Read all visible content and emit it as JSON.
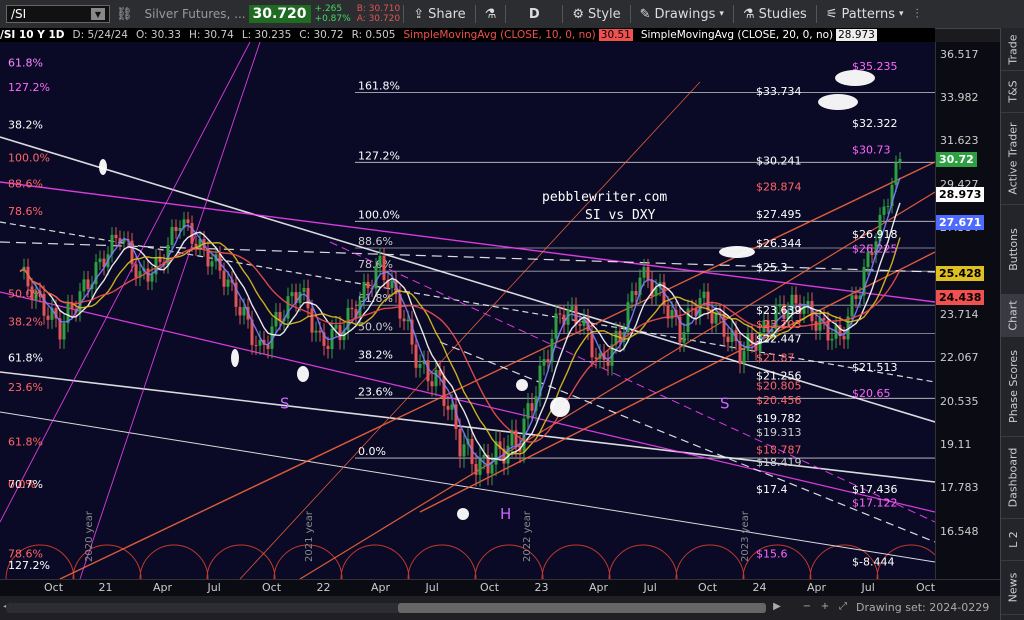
{
  "toolbar": {
    "symbol": "/SI",
    "description": "Silver Futures, ...",
    "last": "30.720",
    "net_change": "+.265",
    "pct_change": "+0.87%",
    "bid": "B: 30.710",
    "ask": "A: 30.720",
    "share_label": "Share",
    "period_label": "D",
    "style_label": "Style",
    "drawings_label": "Drawings",
    "studies_label": "Studies",
    "patterns_label": "Patterns"
  },
  "study_bar": {
    "symbol_period": "/SI 10 Y 1D",
    "date": "D: 5/24/24",
    "open": "O: 30.33",
    "high": "H: 30.74",
    "low": "L: 30.235",
    "close": "C: 30.72",
    "range": "R: 0.505",
    "sma10_label": "SimpleMovingAvg (CLOSE, 10, 0, no)",
    "sma10_value": "30.51",
    "sma20_label": "SimpleMovingAvg (CLOSE, 20, 0, no)",
    "sma20_value": "28.973"
  },
  "chart_data": {
    "type": "line",
    "title": "",
    "watermark": [
      "pebblewriter.com",
      "SI vs DXY"
    ],
    "x_ticks": [
      "Oct",
      "21",
      "Apr",
      "Jul",
      "Oct",
      "22",
      "Apr",
      "Jul",
      "Oct",
      "23",
      "Apr",
      "Jul",
      "Oct",
      "24",
      "Apr",
      "Jul",
      "Oct"
    ],
    "year_labels": [
      "2020 year",
      "2021 year",
      "2022 year",
      "2023 year"
    ],
    "y_ticks": [
      36.517,
      33.982,
      31.623,
      29.427,
      27.384,
      25.482,
      23.714,
      22.067,
      20.535,
      19.11,
      17.783,
      16.548
    ],
    "ylim": [
      15.3,
      37.3
    ],
    "log_scale": true,
    "price_labels": [
      {
        "value": 30.72,
        "text": "30.72",
        "color": "#2ea043"
      },
      {
        "value": 28.973,
        "text": "28.973",
        "color": "#ffffff"
      },
      {
        "value": 27.671,
        "text": "27.671",
        "color": "#4f6bff"
      },
      {
        "value": 25.428,
        "text": "25.428",
        "color": "#e0c020"
      },
      {
        "value": 24.438,
        "text": "24.438",
        "color": "#f05050"
      }
    ],
    "series": [
      {
        "name": "SimpleMovingAvg (CLOSE, 10, 0, no)",
        "color": "#8080ff"
      },
      {
        "name": "SimpleMovingAvg (CLOSE, 20, 0, no)",
        "color": "#ffffff"
      }
    ],
    "close_path": [
      [
        "2020-09",
        25.5
      ],
      [
        "2020-10",
        24.2
      ],
      [
        "2020-11",
        23.2
      ],
      [
        "2020-12",
        24.5
      ],
      [
        "2021-01",
        25.8
      ],
      [
        "2021-02",
        27.2
      ],
      [
        "2021-03",
        25.2
      ],
      [
        "2021-04",
        25.8
      ],
      [
        "2021-05",
        27.8
      ],
      [
        "2021-06",
        26.5
      ],
      [
        "2021-07",
        25.6
      ],
      [
        "2021-08",
        24.0
      ],
      [
        "2021-09",
        22.3
      ],
      [
        "2021-10",
        23.7
      ],
      [
        "2021-11",
        24.8
      ],
      [
        "2021-12",
        22.6
      ],
      [
        "2022-01",
        23.1
      ],
      [
        "2022-02",
        24.3
      ],
      [
        "2022-03",
        25.8
      ],
      [
        "2022-04",
        24.0
      ],
      [
        "2022-05",
        21.7
      ],
      [
        "2022-06",
        21.2
      ],
      [
        "2022-07",
        19.2
      ],
      [
        "2022-08",
        18.4
      ],
      [
        "2022-09",
        18.9
      ],
      [
        "2022-10",
        19.3
      ],
      [
        "2022-11",
        21.4
      ],
      [
        "2022-12",
        23.8
      ],
      [
        "2023-01",
        23.6
      ],
      [
        "2023-02",
        21.8
      ],
      [
        "2023-03",
        22.9
      ],
      [
        "2023-04",
        25.4
      ],
      [
        "2023-05",
        24.6
      ],
      [
        "2023-06",
        23.0
      ],
      [
        "2023-07",
        24.4
      ],
      [
        "2023-08",
        23.4
      ],
      [
        "2023-09",
        22.3
      ],
      [
        "2023-10",
        22.9
      ],
      [
        "2023-11",
        23.9
      ],
      [
        "2023-12",
        24.2
      ],
      [
        "2024-01",
        23.3
      ],
      [
        "2024-02",
        22.8
      ],
      [
        "2024-03",
        24.9
      ],
      [
        "2024-04",
        27.6
      ],
      [
        "2024-05",
        30.72
      ]
    ],
    "fib_levels": [
      {
        "text": "161.8%",
        "value": 34.3,
        "color": "#ffffff"
      },
      {
        "text": "127.2%",
        "value": 30.55,
        "color": "#ffffff"
      },
      {
        "text": "100.0%",
        "value": 27.7,
        "color": "#ffffff"
      },
      {
        "text": "88.6%",
        "value": 26.5,
        "color": "#cccccc"
      },
      {
        "text": "78.6%",
        "value": 25.5,
        "color": "#cccccc"
      },
      {
        "text": "61.8%",
        "value": 24.1,
        "color": "#cccccc"
      },
      {
        "text": "50.0%",
        "value": 23.0,
        "color": "#cccccc"
      },
      {
        "text": "38.2%",
        "value": 21.95,
        "color": "#ffffff"
      },
      {
        "text": "23.6%",
        "value": 20.65,
        "color": "#ffffff"
      },
      {
        "text": "0.0%",
        "value": 18.7,
        "color": "#ffffff"
      }
    ],
    "right_price_annotations": [
      {
        "text": "$35.235",
        "value": 35.6,
        "color": "#ff66ff"
      },
      {
        "text": "$33.734",
        "value": 34.15,
        "color": "#ffffff"
      },
      {
        "text": "$32.322",
        "value": 32.4,
        "color": "#ffffff"
      },
      {
        "text": "$30.73",
        "value": 31.0,
        "color": "#ff66ff"
      },
      {
        "text": "$30.241",
        "value": 30.45,
        "color": "#ffffff"
      },
      {
        "text": "$28.874",
        "value": 29.15,
        "color": "#ff6666"
      },
      {
        "text": "$27.495",
        "value": 27.85,
        "color": "#ffffff"
      },
      {
        "text": "$26.918",
        "value": 26.95,
        "color": "#ffffff"
      },
      {
        "text": "$26.344",
        "value": 26.55,
        "color": "#ffffff"
      },
      {
        "text": "$26.225",
        "value": 26.3,
        "color": "#ff66ff"
      },
      {
        "text": "$25.3",
        "value": 25.5,
        "color": "#ffffff"
      },
      {
        "text": "$23.639",
        "value": 23.75,
        "color": "#ffffff"
      },
      {
        "text": "$23.203",
        "value": 23.2,
        "color": "#ff6666"
      },
      {
        "text": "$22.447",
        "value": 22.65,
        "color": "#ffffff"
      },
      {
        "text": "$21.87",
        "value": 21.95,
        "color": "#ff6666"
      },
      {
        "text": "$21.513",
        "value": 21.6,
        "color": "#ffffff"
      },
      {
        "text": "$21.256",
        "value": 21.3,
        "color": "#ffffff"
      },
      {
        "text": "$20.805",
        "value": 20.95,
        "color": "#ff6666"
      },
      {
        "text": "$20.65",
        "value": 20.7,
        "color": "#ff66ff"
      },
      {
        "text": "$20.456",
        "value": 20.45,
        "color": "#ff6666"
      },
      {
        "text": "$19.782",
        "value": 19.85,
        "color": "#ffffff"
      },
      {
        "text": "$19.313",
        "value": 19.4,
        "color": "#cccccc"
      },
      {
        "text": "$18.787",
        "value": 18.85,
        "color": "#ff6666"
      },
      {
        "text": "$18.419",
        "value": 18.45,
        "color": "#cccccc"
      },
      {
        "text": "$17.4",
        "value": 17.65,
        "color": "#ffffff"
      },
      {
        "text": "$17.436",
        "value": 17.65,
        "color": "#ffffff"
      },
      {
        "text": "$17.122",
        "value": 17.25,
        "color": "#ff66ff"
      },
      {
        "text": "$15.6",
        "value": 15.85,
        "color": "#ff66ff"
      },
      {
        "text": "$-8.444",
        "value": 15.65,
        "color": "#ffffff"
      }
    ],
    "left_labels": [
      {
        "text": "61.8%",
        "value": 35.8,
        "color": "#ff88ff"
      },
      {
        "text": "127.2%",
        "value": 34.4,
        "color": "#ff66ff"
      },
      {
        "text": "38.2%",
        "value": 32.3,
        "color": "#ffffff"
      },
      {
        "text": "100.0%",
        "value": 30.6,
        "color": "#ff6666"
      },
      {
        "text": "88.6%",
        "value": 29.3,
        "color": "#ff6666"
      },
      {
        "text": "78.6%",
        "value": 28.0,
        "color": "#ff6666"
      },
      {
        "text": "50.0%",
        "value": 24.4,
        "color": "#ff6666"
      },
      {
        "text": "38.2%",
        "value": 23.3,
        "color": "#ff6666"
      },
      {
        "text": "61.8%",
        "value": 21.95,
        "color": "#ffffff"
      },
      {
        "text": "23.6%",
        "value": 20.9,
        "color": "#ff6666"
      },
      {
        "text": "61.8%",
        "value": 19.1,
        "color": "#ff6666"
      },
      {
        "text": "70.7%",
        "value": 17.8,
        "color": "#ffffff"
      },
      {
        "text": "0.0%",
        "value": 17.8,
        "color": "#ff6666"
      },
      {
        "text": "78.6%",
        "value": 15.85,
        "color": "#ff6666"
      },
      {
        "text": "127.2%",
        "value": 15.55,
        "color": "#ffffff"
      }
    ],
    "pattern_marks": [
      {
        "text": "S",
        "date": "2021-10",
        "value": 20.3
      },
      {
        "text": "H",
        "date": "2022-09",
        "value": 16.9
      },
      {
        "text": "S",
        "date": "2023-08",
        "value": 20.3
      }
    ]
  },
  "drawing_set": "Drawing set: 2024-0229",
  "side_tabs": [
    "Trade",
    "T&S",
    "Active Trader",
    "Buttons",
    "Chart",
    "Phase Scores",
    "Dashboard",
    "L 2",
    "News"
  ],
  "colors": {
    "plot_bg": "#0a0a26",
    "up_candle": "#2ea043",
    "down_candle": "#e05555",
    "fib_white": "#ffffff",
    "fib_magenta": "#ff44ff",
    "fib_orange": "#ff6a3d"
  }
}
